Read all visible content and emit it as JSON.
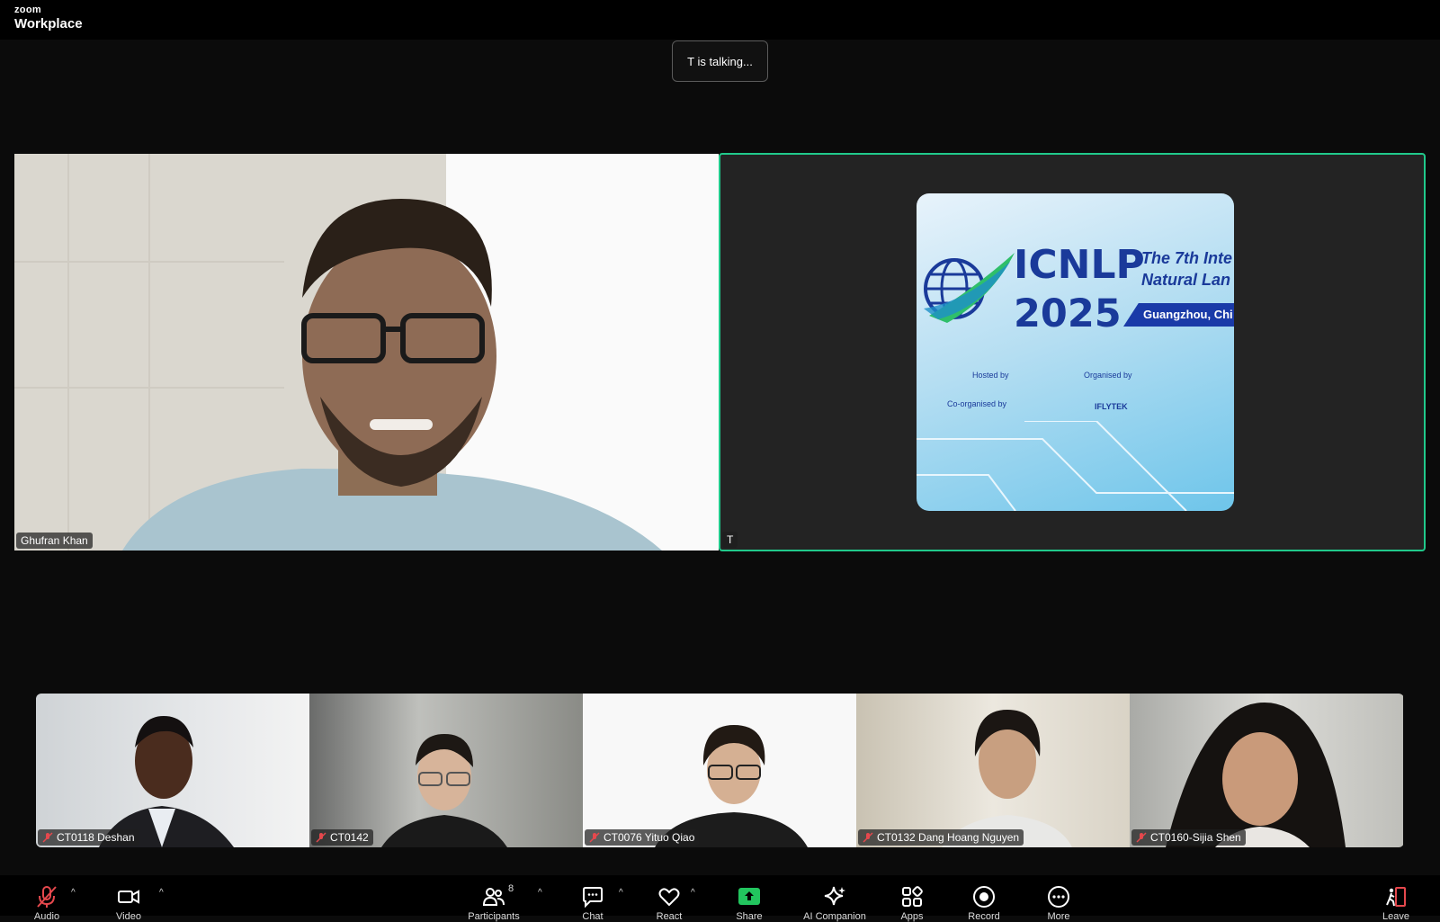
{
  "app": {
    "brand_small": "zoom",
    "brand_large": "Workplace"
  },
  "talking_indicator": "T is talking...",
  "main_tiles": [
    {
      "name": "Ghufran Khan"
    },
    {
      "name": "T"
    }
  ],
  "shared_slide": {
    "title": "ICNLP",
    "year": "2025",
    "subtitle_line1": "The 7th Inte",
    "subtitle_line2": "Natural Lan",
    "city": "Guangzhou, Chi",
    "hosted_by": "Hosted by",
    "organised_by": "Organised by",
    "co_organised_by": "Co-organised by",
    "iflytek": "IFLYTEK"
  },
  "thumbnails": [
    {
      "name": "CT0118 Deshan",
      "muted": true
    },
    {
      "name": "CT0142",
      "muted": true
    },
    {
      "name": "CT0076 Yituo Qiao",
      "muted": true
    },
    {
      "name": "CT0132 Dang Hoang Nguyen",
      "muted": true
    },
    {
      "name": "CT0160-Sijia Shen",
      "muted": true
    }
  ],
  "toolbar": {
    "audio": "Audio",
    "video": "Video",
    "participants": "Participants",
    "participants_count": "8",
    "chat": "Chat",
    "react": "React",
    "share": "Share",
    "ai_companion": "AI Companion",
    "apps": "Apps",
    "record": "Record",
    "more": "More",
    "leave": "Leave"
  },
  "colors": {
    "active_speaker_border": "#21c98b",
    "share_green": "#22c55e",
    "muted_red": "#e5484d"
  }
}
